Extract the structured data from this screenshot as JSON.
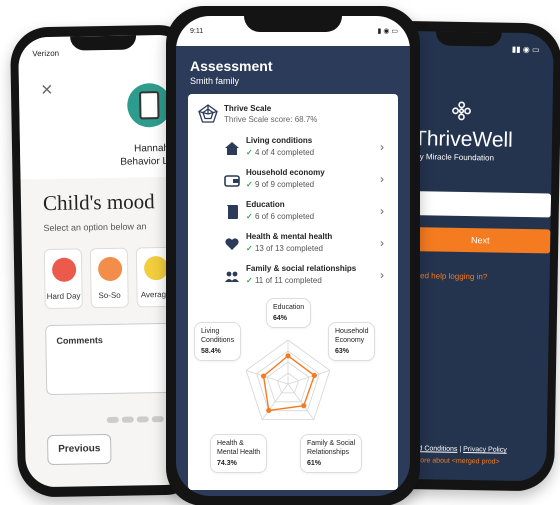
{
  "left_phone": {
    "status_carrier": "Verizon",
    "close_symbol": "×",
    "name": "Hannah",
    "name2": "Behavior L",
    "heading": "Child's mood",
    "subheading": "Select an option below an",
    "moods": [
      {
        "label": "Hard Day",
        "color": "#ec5a4c"
      },
      {
        "label": "So-So",
        "color": "#f38d4a"
      },
      {
        "label": "Average",
        "color": "#f2cd3d"
      }
    ],
    "comments_label": "Comments",
    "previous_button": "Previous"
  },
  "center_phone": {
    "status_time": "9:11",
    "title": "Assessment",
    "subtitle": "Smith family",
    "scale_title": "Thrive Scale",
    "scale_score": "Thrive Scale score: 68.7%",
    "items": [
      {
        "title": "Living conditions",
        "status": "4 of 4 completed",
        "icon": "house-icon"
      },
      {
        "title": "Household economy",
        "status": "9 of 9 completed",
        "icon": "wallet-icon"
      },
      {
        "title": "Education",
        "status": "6 of 6 completed",
        "icon": "book-icon"
      },
      {
        "title": "Health & mental health",
        "status": "13 of 13 completed",
        "icon": "heart-icon"
      },
      {
        "title": "Family & social relationships",
        "status": "11 of 11 completed",
        "icon": "people-icon"
      }
    ],
    "radar": [
      {
        "line1": "Education",
        "line2": "",
        "value_text": "64%",
        "value": 64
      },
      {
        "line1": "Household",
        "line2": "Economy",
        "value_text": "63%",
        "value": 63
      },
      {
        "line1": "Family & Social",
        "line2": "Relationships",
        "value_text": "61%",
        "value": 61
      },
      {
        "line1": "Health &",
        "line2": "Mental Health",
        "value_text": "74.3%",
        "value": 74.3
      },
      {
        "line1": "Living",
        "line2": "Conditions",
        "value_text": "58.4%",
        "value": 58.4
      }
    ]
  },
  "right_phone": {
    "brand": "ThriveWell",
    "brand_sub": "y Miracle Foundation",
    "next_button": "Next",
    "help_link": "eed help logging in?",
    "terms_link": "nd Conditions",
    "separator": "|",
    "privacy_link": "Privacy Policy",
    "more_link": "more about <merged prod>"
  },
  "colors": {
    "navy": "#2b3b59",
    "accent": "#f47b20",
    "check": "#39a845"
  }
}
